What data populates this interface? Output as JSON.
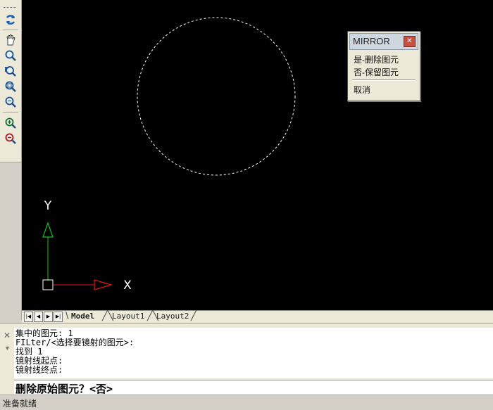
{
  "toolbar": {
    "buttons": [
      {
        "name": "redraw-icon"
      },
      {
        "name": "pan-hand-icon"
      },
      {
        "name": "zoom-realtime-icon"
      },
      {
        "name": "zoom-previous-icon"
      },
      {
        "name": "zoom-window-icon"
      },
      {
        "name": "zoom-extents-icon"
      },
      {
        "name": "zoom-in-icon"
      },
      {
        "name": "zoom-out-icon"
      }
    ]
  },
  "canvas": {
    "background": "#000000",
    "selection_color": "#ffffff",
    "ucs": {
      "x_label": "X",
      "y_label": "Y",
      "x_color": "#e01818",
      "y_color": "#18c018"
    }
  },
  "mirror_menu": {
    "title": "MIRROR",
    "items": [
      "是-删除图元",
      "否-保留图元",
      "取消"
    ]
  },
  "tabs": {
    "nav": [
      "first-tab",
      "previous-tab",
      "next-tab",
      "last-tab"
    ],
    "items": [
      "Model",
      "Layout1",
      "Layout2"
    ],
    "active": "Model"
  },
  "command": {
    "history": [
      "集中的图元: 1",
      "FILter/<选择要镜射的图元>:",
      "找到 1",
      "镜射线起点:",
      "镜射线终点:"
    ],
    "prompt": "删除原始图元？<否>"
  },
  "status": {
    "text": "准备就绪"
  }
}
